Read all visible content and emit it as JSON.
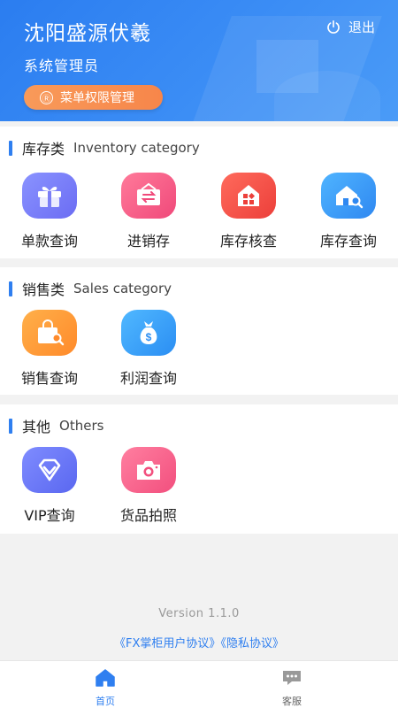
{
  "header": {
    "company": "沈阳盛源伏羲",
    "role": "系统管理员",
    "logout_label": "退出",
    "menu_perm_icon": "Ⓡ",
    "menu_perm_label": "菜单权限管理"
  },
  "sections": {
    "inventory": {
      "title_zh": "库存类",
      "title_en": "Inventory category",
      "items": [
        {
          "label": "单款查询",
          "icon": "gift-icon",
          "color": "#6b6cf3"
        },
        {
          "label": "进销存",
          "icon": "exchange-icon",
          "color": "#f0497a"
        },
        {
          "label": "库存核查",
          "icon": "house-grid-icon",
          "color": "#ec3f3a"
        },
        {
          "label": "库存查询",
          "icon": "house-search-icon",
          "color": "#2f88f1"
        }
      ]
    },
    "sales": {
      "title_zh": "销售类",
      "title_en": "Sales category",
      "items": [
        {
          "label": "销售查询",
          "icon": "shopping-bag-search-icon",
          "color": "#ff8a2a"
        },
        {
          "label": "利润查询",
          "icon": "money-bag-icon",
          "color": "#2b8ef3"
        }
      ]
    },
    "others": {
      "title_zh": "其他",
      "title_en": "Others",
      "items": [
        {
          "label": "VIP查询",
          "icon": "diamond-icon",
          "color": "#5a67f0"
        },
        {
          "label": "货品拍照",
          "icon": "camera-icon",
          "color": "#f24f7e"
        }
      ]
    }
  },
  "footer": {
    "version": "Version 1.1.0",
    "user_agreement": "《FX掌柜用户协议》",
    "privacy_policy": "《隐私协议》"
  },
  "tabbar": {
    "home_label": "首页",
    "service_label": "客服",
    "active_color": "#2f7ff0"
  }
}
